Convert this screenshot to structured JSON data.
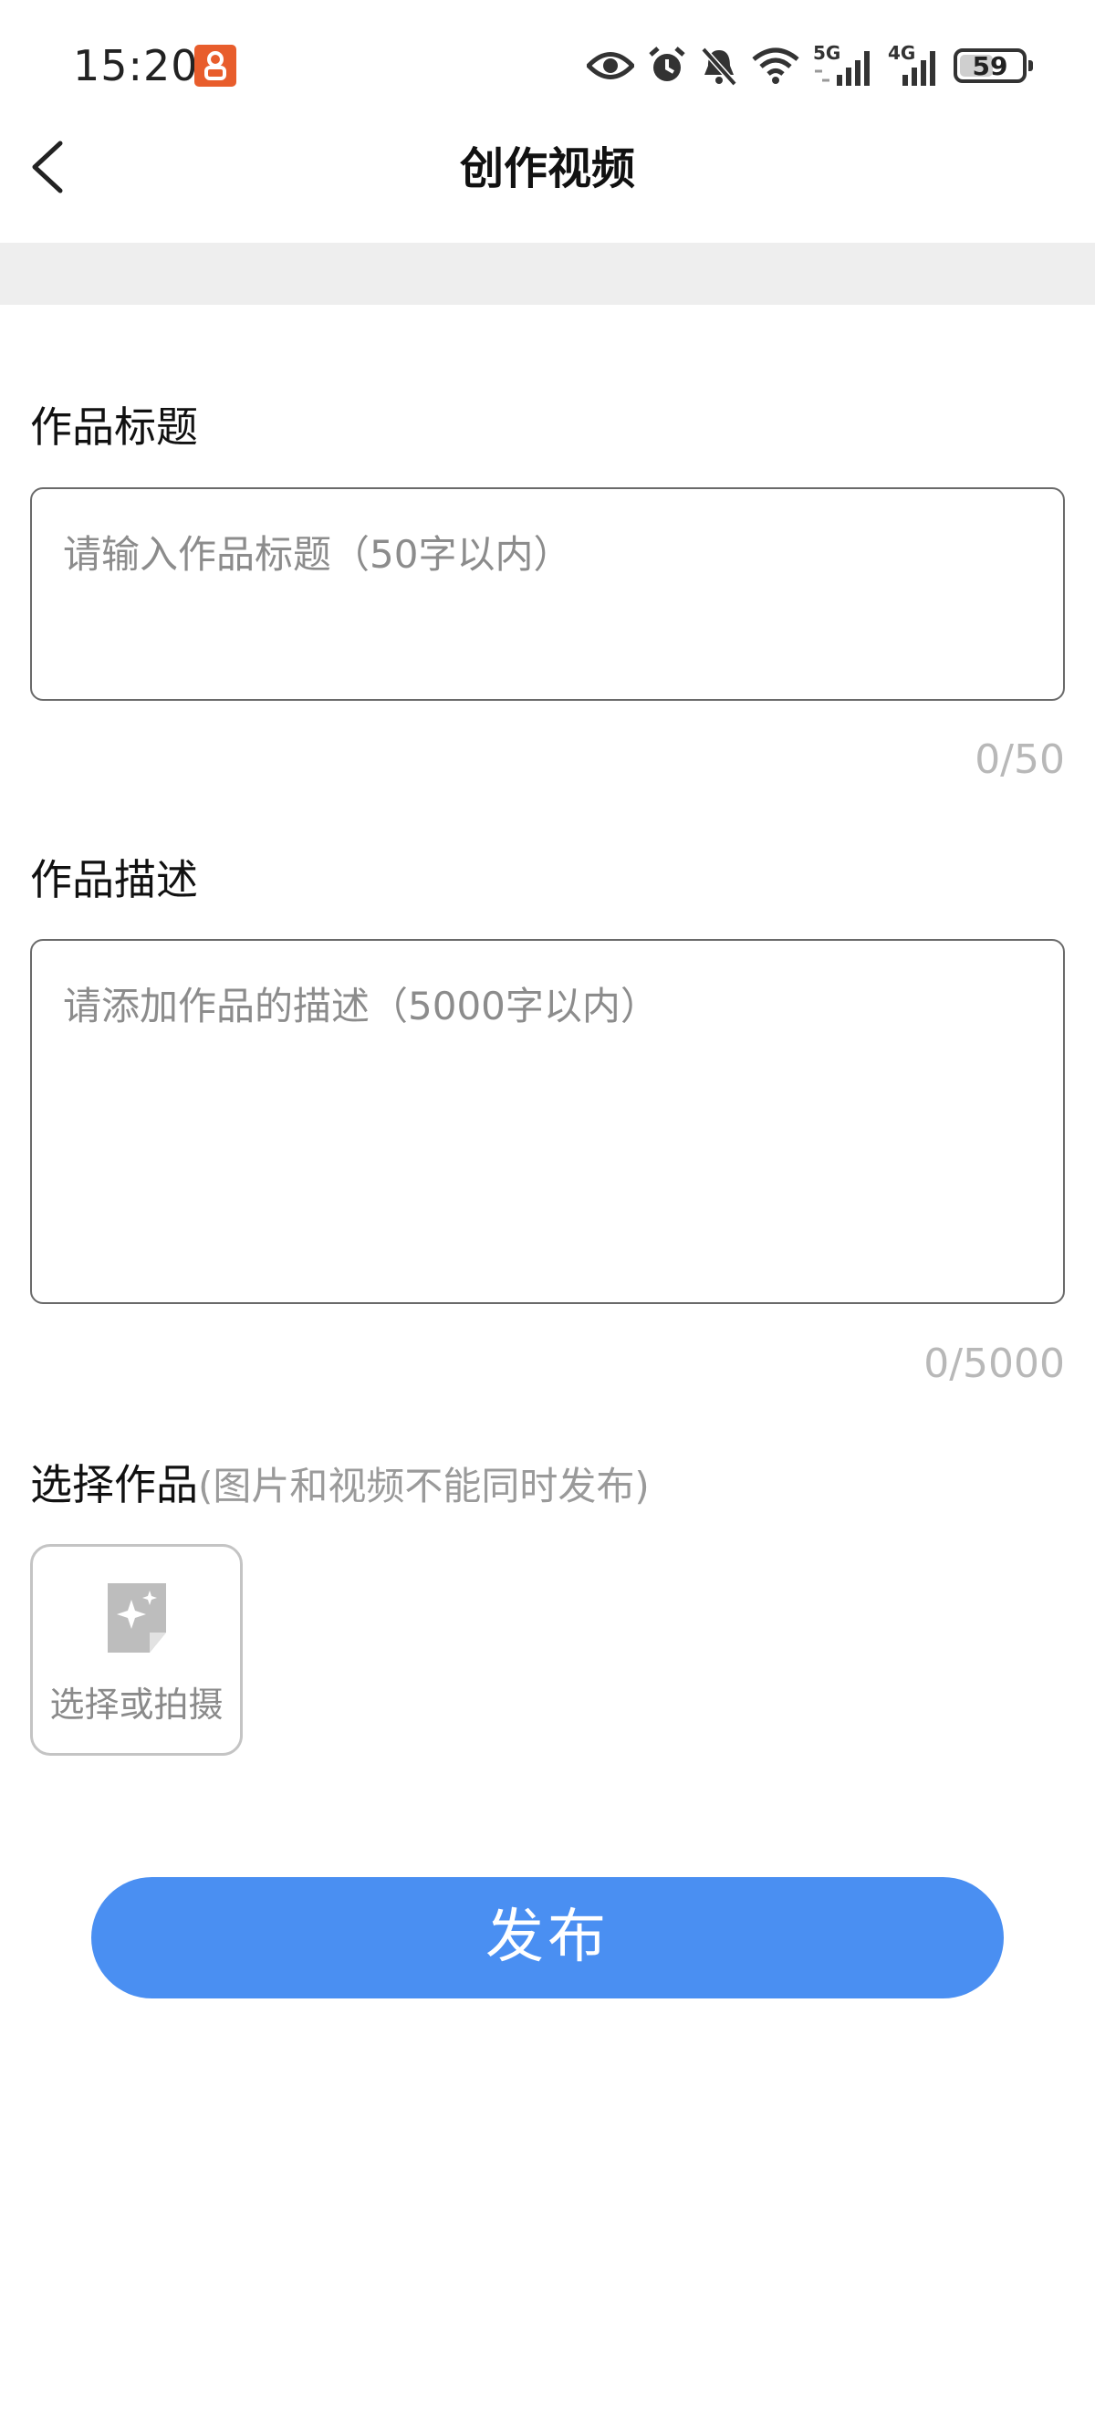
{
  "status_bar": {
    "time": "15:20",
    "network_5g": "5G",
    "network_4g": "4G",
    "battery_percent": "59",
    "battery_level": 0.59,
    "icons": [
      "app-badge-icon",
      "eye-icon",
      "alarm-icon",
      "muted-bell-icon",
      "wifi-icon",
      "signal-5g-icon",
      "signal-4g-icon",
      "battery-icon"
    ]
  },
  "nav": {
    "back_icon": "chevron-left-icon",
    "title": "创作视频"
  },
  "form": {
    "title_label": "作品标题",
    "title_placeholder": "请输入作品标题（50字以内）",
    "title_value": "",
    "title_counter": "0/50",
    "desc_label": "作品描述",
    "desc_placeholder": "请添加作品的描述（5000字以内）",
    "desc_value": "",
    "desc_counter": "0/5000",
    "media_label": "选择作品",
    "media_hint": "(图片和视频不能同时发布)",
    "pick_icon": "sparkle-note-icon",
    "pick_label": "选择或拍摄"
  },
  "actions": {
    "publish_label": "发布"
  },
  "colors": {
    "accent": "#4a8ff2",
    "badge": "#e85d2c",
    "divider": "#eeeeee",
    "placeholder": "#8c8c8c",
    "counter": "#b8b8b8"
  }
}
